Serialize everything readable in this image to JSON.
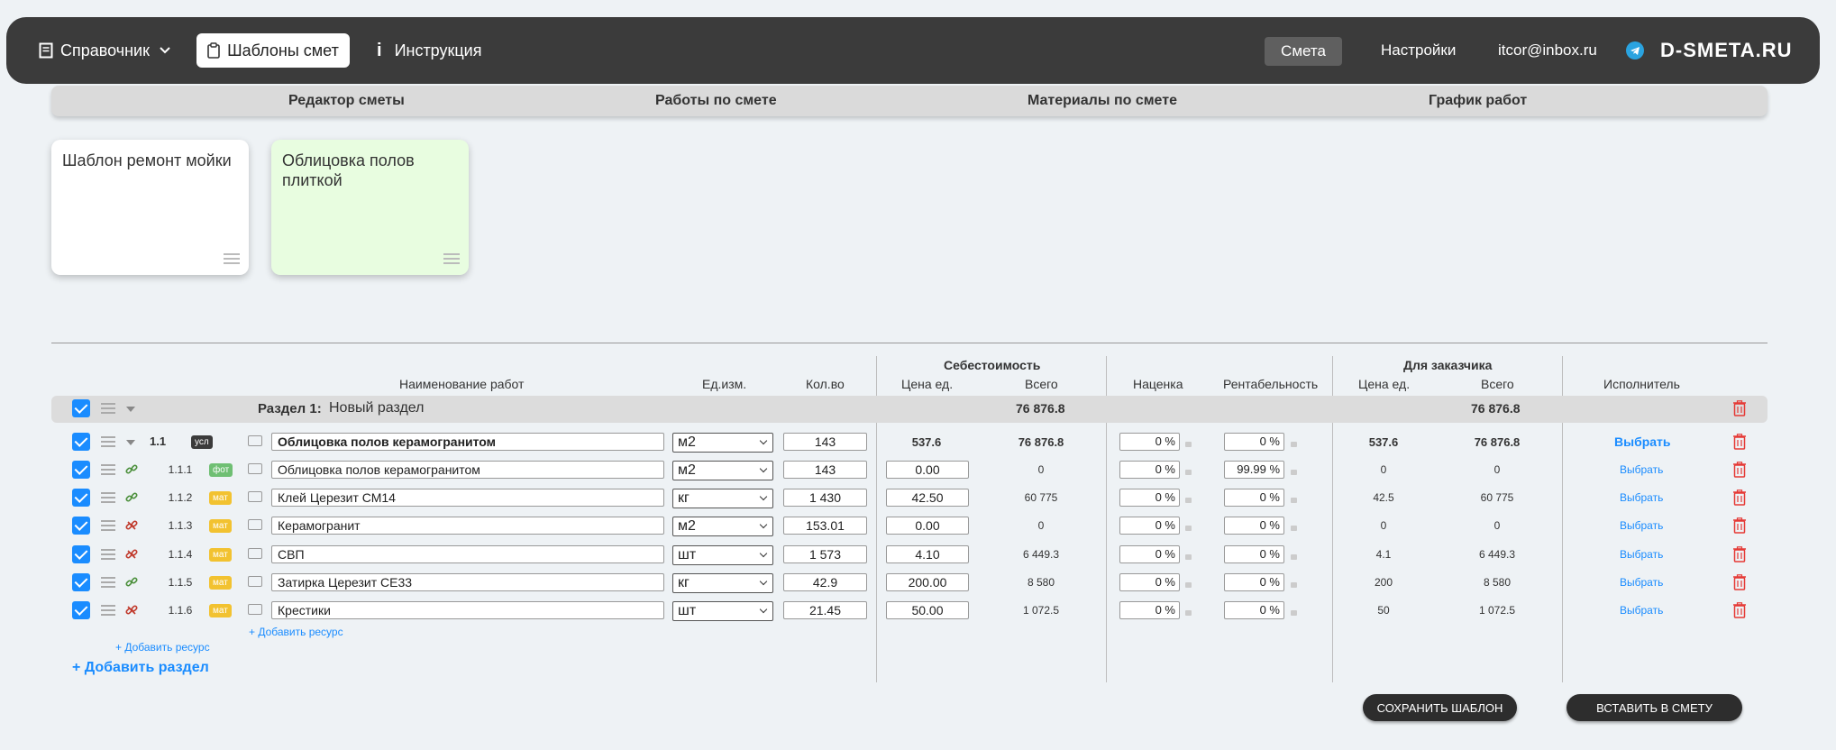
{
  "topbar": {
    "reference_label": "Справочник",
    "templates_label": "Шаблоны смет",
    "instruction_label": "Инструкция",
    "smeta_label": "Смета",
    "settings_label": "Настройки",
    "user_email": "itcor@inbox.ru",
    "logo_text": "D-SMETA.RU",
    "telegram_icon": "telegram-icon"
  },
  "tabs": [
    "Редактор сметы",
    "Работы по смете",
    "Материалы по смете",
    "График работ"
  ],
  "templates": [
    {
      "title": "Шаблон ремонт мойки",
      "color": "#ffffff"
    },
    {
      "title": "Облицовка полов плиткой",
      "color": "#e8fde0"
    }
  ],
  "table": {
    "group_cost": "Себестоимость",
    "group_customer": "Для заказчика",
    "col_name": "Наименование работ",
    "col_unit": "Ед.изм.",
    "col_qty": "Кол.во",
    "col_price": "Цена ед.",
    "col_total": "Всего",
    "col_markup": "Наценка",
    "col_profit": "Рентабельность",
    "col_cust_price": "Цена ед.",
    "col_cust_total": "Всего",
    "col_executor": "Исполнитель"
  },
  "section": {
    "label": "Раздел 1:",
    "name": "Новый раздел",
    "cost_total": "76 876.8",
    "customer_total": "76 876.8"
  },
  "rows": [
    {
      "num": "1.1",
      "badge": "усл",
      "badge_color": "#3b3b3b",
      "name": "Облицовка полов керамогранитом",
      "unit": "м2",
      "qty": "143",
      "price": "537.6",
      "total": "76 876.8",
      "markup": "0 %",
      "profit": "0 %",
      "cprice": "537.6",
      "ctotal": "76 876.8",
      "executor": "Выбрать"
    },
    {
      "num": "1.1.1",
      "badge": "фот",
      "badge_color": "#6fbf73",
      "name": "Облицовка полов керамогранитом",
      "unit": "м2",
      "qty": "143",
      "price": "0.00",
      "total": "0",
      "markup": "0 %",
      "profit": "99.99 %",
      "cprice": "0",
      "ctotal": "0",
      "executor": "Выбрать"
    },
    {
      "num": "1.1.2",
      "badge": "мат",
      "badge_color": "#f2c230",
      "name": "Клей Церезит СМ14",
      "unit": "кг",
      "qty": "1 430",
      "price": "42.50",
      "total": "60 775",
      "markup": "0 %",
      "profit": "0 %",
      "cprice": "42.5",
      "ctotal": "60 775",
      "executor": "Выбрать"
    },
    {
      "num": "1.1.3",
      "badge": "мат",
      "badge_color": "#f2c230",
      "name": "Керамогранит",
      "unit": "м2",
      "qty": "153.01",
      "price": "0.00",
      "total": "0",
      "markup": "0 %",
      "profit": "0 %",
      "cprice": "0",
      "ctotal": "0",
      "executor": "Выбрать"
    },
    {
      "num": "1.1.4",
      "badge": "мат",
      "badge_color": "#f2c230",
      "name": "СВП",
      "unit": "шт",
      "qty": "1 573",
      "price": "4.10",
      "total": "6 449.3",
      "markup": "0 %",
      "profit": "0 %",
      "cprice": "4.1",
      "ctotal": "6 449.3",
      "executor": "Выбрать"
    },
    {
      "num": "1.1.5",
      "badge": "мат",
      "badge_color": "#f2c230",
      "name": "Затирка Церезит СЕ33",
      "unit": "кг",
      "qty": "42.9",
      "price": "200.00",
      "total": "8 580",
      "markup": "0 %",
      "profit": "0 %",
      "cprice": "200",
      "ctotal": "8 580",
      "executor": "Выбрать"
    },
    {
      "num": "1.1.6",
      "badge": "мат",
      "badge_color": "#f2c230",
      "name": "Крестики",
      "unit": "шт",
      "qty": "21.45",
      "price": "50.00",
      "total": "1 072.5",
      "markup": "0 %",
      "profit": "0 %",
      "cprice": "50",
      "ctotal": "1 072.5",
      "executor": "Выбрать"
    }
  ],
  "add_resource_1": "+ Добавить ресурс",
  "add_resource_2": "+ Добавить ресурс",
  "add_section": "+ Добавить раздел",
  "save_template": "СОХРАНИТЬ ШАБЛОН",
  "insert_to_smeta": "ВСТАВИТЬ В СМЕТУ",
  "colors": {
    "accent": "#1a8cff",
    "topbar": "#3b3b3b",
    "delete": "#e53935"
  }
}
